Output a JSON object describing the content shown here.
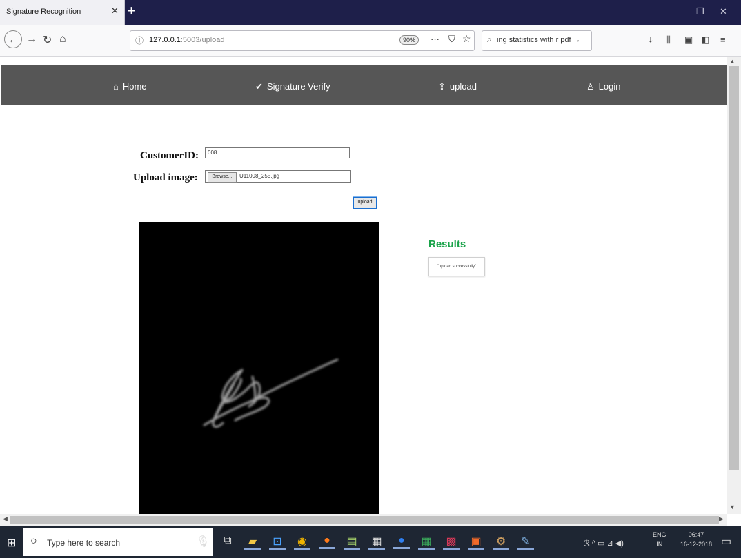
{
  "browser": {
    "tab_title": "Signature Recognition",
    "tab_close": "✕",
    "new_tab": "+",
    "url_prefix": "127.0.0.1",
    "url_rest": ":5003/upload",
    "zoom": "90%",
    "page_actions": "···",
    "search_text": "ing statistics with r pdf →",
    "window_controls": [
      "—",
      "❐",
      "✕"
    ]
  },
  "site_nav": {
    "home": "Home",
    "signature_verify": "Signature Verify",
    "upload": "upload",
    "login": "Login"
  },
  "form": {
    "customer_id_label": "CustomerID:",
    "customer_id_value": "008",
    "upload_image_label": "Upload image:",
    "browse_label": "Browse...",
    "file_name": "U11008_255.jpg",
    "upload_button": "upload"
  },
  "results": {
    "title": "Results",
    "message": "\"upload successfully\""
  },
  "taskbar": {
    "search_placeholder": "Type here to search",
    "language": "ENG",
    "region": "IN",
    "time": "06:47",
    "date": "16-12-2018"
  },
  "icons": {
    "home": "home-icon",
    "verify": "check-circle-icon",
    "upload": "upload-icon",
    "login": "user-icon"
  },
  "colors": {
    "tabbar_bg": "#1e1f4a",
    "site_nav_bg": "#565656",
    "results_green": "#1aa34a",
    "taskbar_bg": "#1e2633"
  }
}
